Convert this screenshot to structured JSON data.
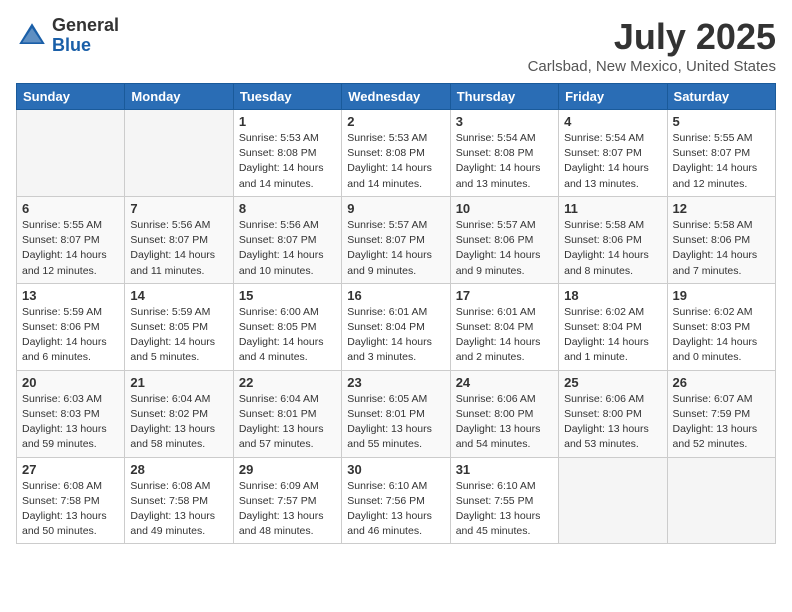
{
  "header": {
    "logo_general": "General",
    "logo_blue": "Blue",
    "title": "July 2025",
    "location": "Carlsbad, New Mexico, United States"
  },
  "weekdays": [
    "Sunday",
    "Monday",
    "Tuesday",
    "Wednesday",
    "Thursday",
    "Friday",
    "Saturday"
  ],
  "weeks": [
    [
      {
        "day": "",
        "info": ""
      },
      {
        "day": "",
        "info": ""
      },
      {
        "day": "1",
        "info": "Sunrise: 5:53 AM\nSunset: 8:08 PM\nDaylight: 14 hours\nand 14 minutes."
      },
      {
        "day": "2",
        "info": "Sunrise: 5:53 AM\nSunset: 8:08 PM\nDaylight: 14 hours\nand 14 minutes."
      },
      {
        "day": "3",
        "info": "Sunrise: 5:54 AM\nSunset: 8:08 PM\nDaylight: 14 hours\nand 13 minutes."
      },
      {
        "day": "4",
        "info": "Sunrise: 5:54 AM\nSunset: 8:07 PM\nDaylight: 14 hours\nand 13 minutes."
      },
      {
        "day": "5",
        "info": "Sunrise: 5:55 AM\nSunset: 8:07 PM\nDaylight: 14 hours\nand 12 minutes."
      }
    ],
    [
      {
        "day": "6",
        "info": "Sunrise: 5:55 AM\nSunset: 8:07 PM\nDaylight: 14 hours\nand 12 minutes."
      },
      {
        "day": "7",
        "info": "Sunrise: 5:56 AM\nSunset: 8:07 PM\nDaylight: 14 hours\nand 11 minutes."
      },
      {
        "day": "8",
        "info": "Sunrise: 5:56 AM\nSunset: 8:07 PM\nDaylight: 14 hours\nand 10 minutes."
      },
      {
        "day": "9",
        "info": "Sunrise: 5:57 AM\nSunset: 8:07 PM\nDaylight: 14 hours\nand 9 minutes."
      },
      {
        "day": "10",
        "info": "Sunrise: 5:57 AM\nSunset: 8:06 PM\nDaylight: 14 hours\nand 9 minutes."
      },
      {
        "day": "11",
        "info": "Sunrise: 5:58 AM\nSunset: 8:06 PM\nDaylight: 14 hours\nand 8 minutes."
      },
      {
        "day": "12",
        "info": "Sunrise: 5:58 AM\nSunset: 8:06 PM\nDaylight: 14 hours\nand 7 minutes."
      }
    ],
    [
      {
        "day": "13",
        "info": "Sunrise: 5:59 AM\nSunset: 8:06 PM\nDaylight: 14 hours\nand 6 minutes."
      },
      {
        "day": "14",
        "info": "Sunrise: 5:59 AM\nSunset: 8:05 PM\nDaylight: 14 hours\nand 5 minutes."
      },
      {
        "day": "15",
        "info": "Sunrise: 6:00 AM\nSunset: 8:05 PM\nDaylight: 14 hours\nand 4 minutes."
      },
      {
        "day": "16",
        "info": "Sunrise: 6:01 AM\nSunset: 8:04 PM\nDaylight: 14 hours\nand 3 minutes."
      },
      {
        "day": "17",
        "info": "Sunrise: 6:01 AM\nSunset: 8:04 PM\nDaylight: 14 hours\nand 2 minutes."
      },
      {
        "day": "18",
        "info": "Sunrise: 6:02 AM\nSunset: 8:04 PM\nDaylight: 14 hours\nand 1 minute."
      },
      {
        "day": "19",
        "info": "Sunrise: 6:02 AM\nSunset: 8:03 PM\nDaylight: 14 hours\nand 0 minutes."
      }
    ],
    [
      {
        "day": "20",
        "info": "Sunrise: 6:03 AM\nSunset: 8:03 PM\nDaylight: 13 hours\nand 59 minutes."
      },
      {
        "day": "21",
        "info": "Sunrise: 6:04 AM\nSunset: 8:02 PM\nDaylight: 13 hours\nand 58 minutes."
      },
      {
        "day": "22",
        "info": "Sunrise: 6:04 AM\nSunset: 8:01 PM\nDaylight: 13 hours\nand 57 minutes."
      },
      {
        "day": "23",
        "info": "Sunrise: 6:05 AM\nSunset: 8:01 PM\nDaylight: 13 hours\nand 55 minutes."
      },
      {
        "day": "24",
        "info": "Sunrise: 6:06 AM\nSunset: 8:00 PM\nDaylight: 13 hours\nand 54 minutes."
      },
      {
        "day": "25",
        "info": "Sunrise: 6:06 AM\nSunset: 8:00 PM\nDaylight: 13 hours\nand 53 minutes."
      },
      {
        "day": "26",
        "info": "Sunrise: 6:07 AM\nSunset: 7:59 PM\nDaylight: 13 hours\nand 52 minutes."
      }
    ],
    [
      {
        "day": "27",
        "info": "Sunrise: 6:08 AM\nSunset: 7:58 PM\nDaylight: 13 hours\nand 50 minutes."
      },
      {
        "day": "28",
        "info": "Sunrise: 6:08 AM\nSunset: 7:58 PM\nDaylight: 13 hours\nand 49 minutes."
      },
      {
        "day": "29",
        "info": "Sunrise: 6:09 AM\nSunset: 7:57 PM\nDaylight: 13 hours\nand 48 minutes."
      },
      {
        "day": "30",
        "info": "Sunrise: 6:10 AM\nSunset: 7:56 PM\nDaylight: 13 hours\nand 46 minutes."
      },
      {
        "day": "31",
        "info": "Sunrise: 6:10 AM\nSunset: 7:55 PM\nDaylight: 13 hours\nand 45 minutes."
      },
      {
        "day": "",
        "info": ""
      },
      {
        "day": "",
        "info": ""
      }
    ]
  ]
}
